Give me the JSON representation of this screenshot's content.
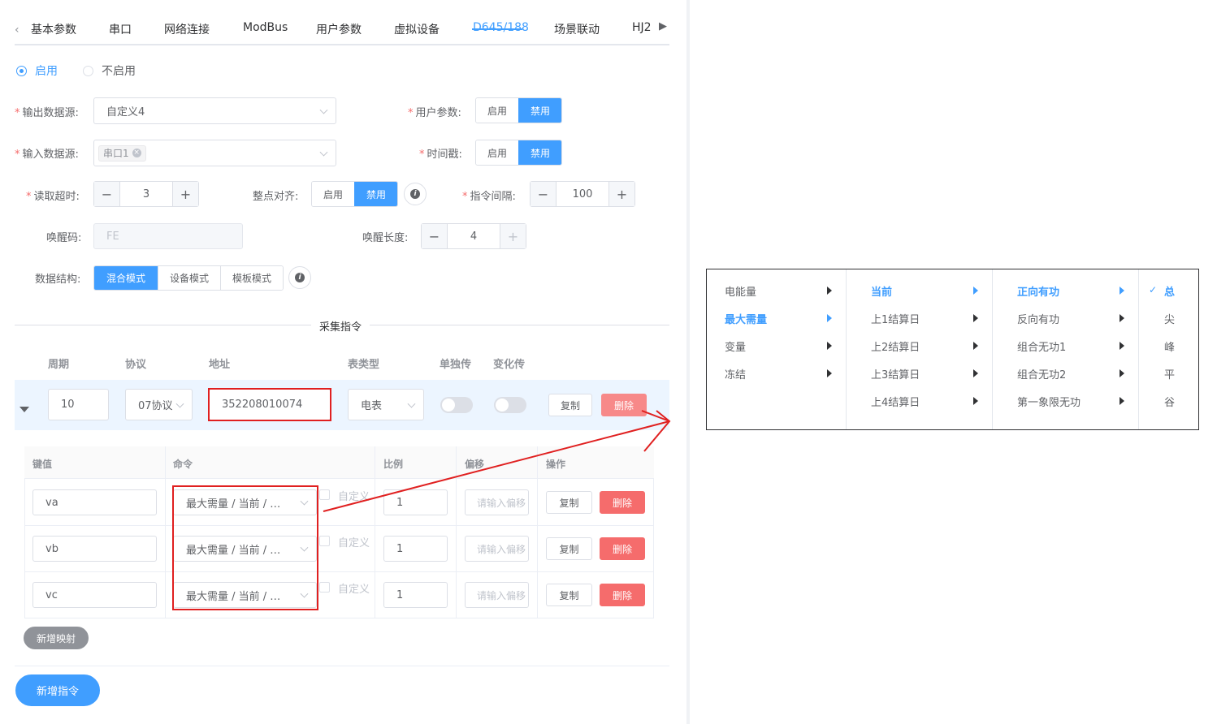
{
  "tabs": {
    "items": [
      "基本参数",
      "串口",
      "网络连接",
      "ModBus",
      "用户参数",
      "虚拟设备",
      "D645/188",
      "场景联动",
      "HJ2"
    ],
    "active": "D645/188"
  },
  "enable": {
    "on": "启用",
    "off": "不启用"
  },
  "form": {
    "output_source": {
      "label": "输出数据源:",
      "value": "自定义4"
    },
    "user_param": {
      "label": "用户参数:",
      "opt_on": "启用",
      "opt_off": "禁用"
    },
    "input_source": {
      "label": "输入数据源:",
      "tag": "串口1"
    },
    "timestamp": {
      "label": "时间戳:",
      "opt_on": "启用",
      "opt_off": "禁用"
    },
    "read_timeout": {
      "label": "读取超时:",
      "value": "3"
    },
    "hour_align": {
      "label": "整点对齐:",
      "opt_on": "启用",
      "opt_off": "禁用"
    },
    "cmd_interval": {
      "label": "指令间隔:",
      "value": "100"
    },
    "wake_code": {
      "label": "唤醒码:",
      "placeholder": "FE"
    },
    "wake_len": {
      "label": "唤醒长度:",
      "value": "4"
    },
    "data_struct": {
      "label": "数据结构:",
      "options": [
        "混合模式",
        "设备模式",
        "模板模式"
      ]
    }
  },
  "section_title": "采集指令",
  "cmd_table": {
    "headers": [
      "周期",
      "协议",
      "地址",
      "表类型",
      "单独传",
      "变化传"
    ],
    "row": {
      "period": "10",
      "protocol": "07协议",
      "address": "352208010074",
      "meter_type": "电表",
      "copy": "复制",
      "delete": "删除"
    }
  },
  "map_table": {
    "headers": [
      "键值",
      "命令",
      "比例",
      "偏移",
      "操作"
    ],
    "rows": [
      {
        "key": "va",
        "command": "最大需量 / 当前 / …",
        "custom": "自定义",
        "ratio": "1",
        "offset_ph": "请输入偏移",
        "copy": "复制",
        "delete": "删除"
      },
      {
        "key": "vb",
        "command": "最大需量 / 当前 / …",
        "custom": "自定义",
        "ratio": "1",
        "offset_ph": "请输入偏移",
        "copy": "复制",
        "delete": "删除"
      },
      {
        "key": "vc",
        "command": "最大需量 / 当前 / …",
        "custom": "自定义",
        "ratio": "1",
        "offset_ph": "请输入偏移",
        "copy": "复制",
        "delete": "删除"
      }
    ]
  },
  "add_map": "新增映射",
  "add_cmd": "新增指令",
  "cascader": {
    "col1": [
      "电能量",
      "最大需量",
      "变量",
      "冻结"
    ],
    "col2": [
      "当前",
      "上1结算日",
      "上2结算日",
      "上3结算日",
      "上4结算日"
    ],
    "col3": [
      "正向有功",
      "反向有功",
      "组合无功1",
      "组合无功2",
      "第一象限无功"
    ],
    "col4": [
      "总",
      "尖",
      "峰",
      "平",
      "谷"
    ],
    "check": "✓"
  },
  "colors": {
    "primary": "#409eff",
    "danger": "#f56c6c",
    "annotation": "#e02020"
  }
}
